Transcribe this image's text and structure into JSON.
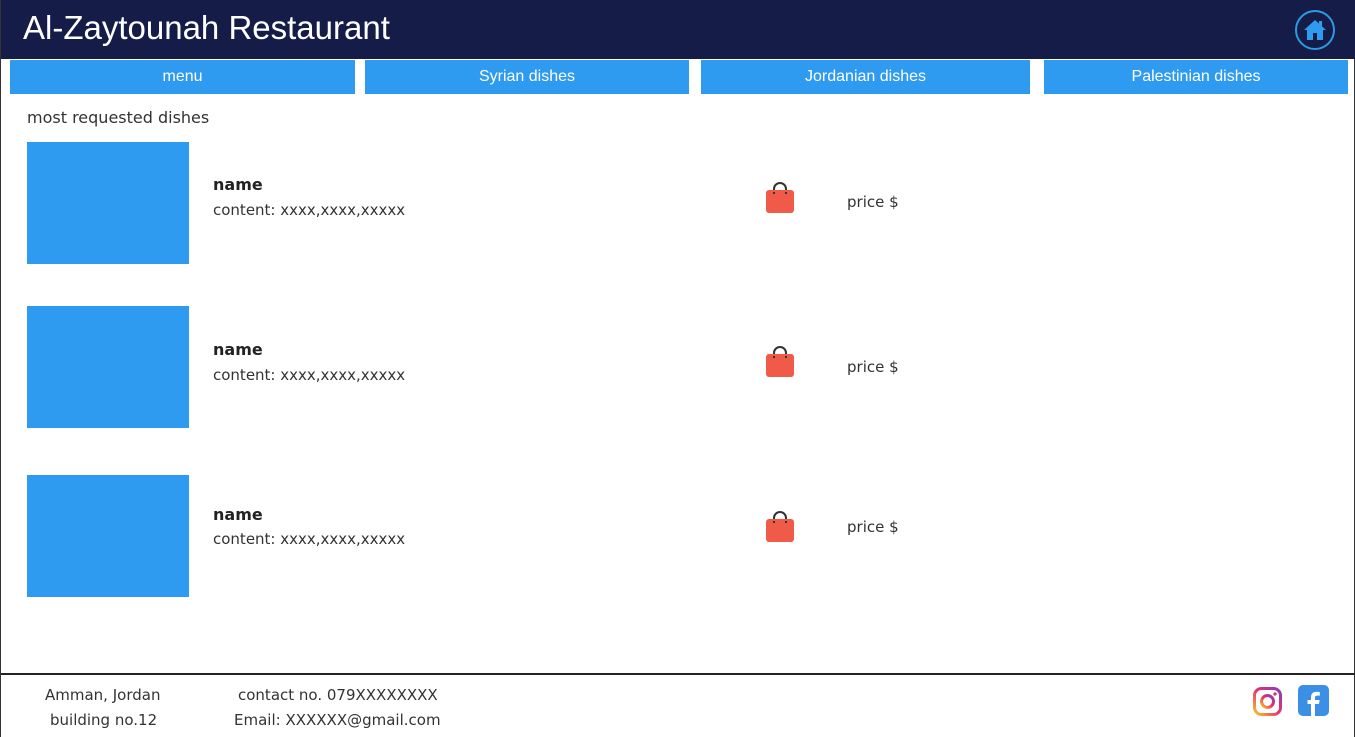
{
  "header": {
    "title": "Al-Zaytounah Restaurant",
    "home_icon": "home-icon"
  },
  "nav": {
    "tabs": [
      {
        "label": "menu"
      },
      {
        "label": "Syrian dishes"
      },
      {
        "label": "Jordanian dishes"
      },
      {
        "label": "Palestinian dishes"
      }
    ]
  },
  "main": {
    "section_title": "most requested dishes",
    "dishes": [
      {
        "name": "name",
        "content": "content: xxxx,xxxx,xxxxx",
        "price": "price $",
        "cart_icon": "shopping-bag-icon"
      },
      {
        "name": "name",
        "content": "content: xxxx,xxxx,xxxxx",
        "price": "price $",
        "cart_icon": "shopping-bag-icon"
      },
      {
        "name": "name",
        "content": "content: xxxx,xxxx,xxxxx",
        "price": "price $",
        "cart_icon": "shopping-bag-icon"
      }
    ]
  },
  "footer": {
    "city": "Amman, Jordan",
    "building": "building no.12",
    "contact": "contact no. 079XXXXXXXX",
    "email": "Email: XXXXXX@gmail.com",
    "social_icons": [
      "instagram-icon",
      "facebook-icon"
    ]
  },
  "colors": {
    "header_bg": "#141c47",
    "accent": "#2e9bf0",
    "cart": "#f05a48"
  }
}
